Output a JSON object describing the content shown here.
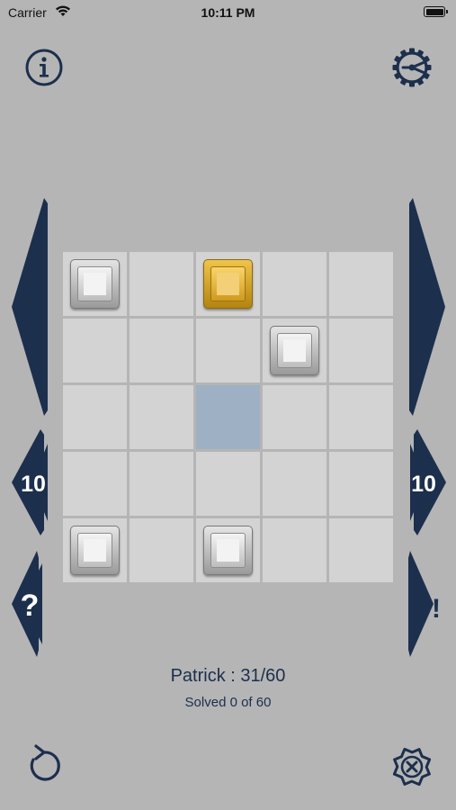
{
  "status_bar": {
    "carrier": "Carrier",
    "time": "10:11 PM"
  },
  "toolbar": {
    "info_icon": "info-circle-icon",
    "settings_icon": "gear-icon",
    "undo_icon": "undo-arrow-icon",
    "reset_icon": "gear-x-icon"
  },
  "side_controls": {
    "prev_big": "left-arrow-icon",
    "next_big": "right-arrow-icon",
    "back_ten": "10",
    "forward_ten": "10",
    "help": "?",
    "hint": "!"
  },
  "board": {
    "rows": 5,
    "cols": 5,
    "highlighted": [
      [
        2,
        2
      ]
    ],
    "pieces": [
      {
        "row": 0,
        "col": 0,
        "type": "white"
      },
      {
        "row": 0,
        "col": 2,
        "type": "gold"
      },
      {
        "row": 1,
        "col": 3,
        "type": "white"
      },
      {
        "row": 4,
        "col": 0,
        "type": "white"
      },
      {
        "row": 4,
        "col": 2,
        "type": "white"
      }
    ]
  },
  "player": {
    "label": "Patrick : 31/60"
  },
  "progress": {
    "label": "Solved 0 of 60"
  },
  "colors": {
    "background": "#b5b5b5",
    "navy": "#1c2f4d",
    "cell": "#d3d3d3",
    "highlight": "#9eb0c4",
    "gold": "#d9a62a"
  }
}
